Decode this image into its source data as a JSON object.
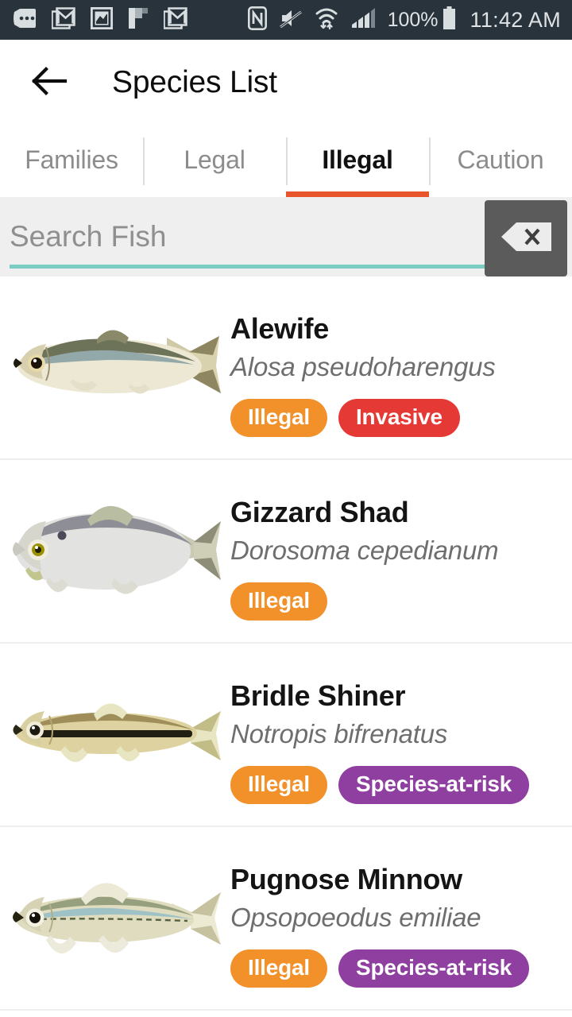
{
  "status_bar": {
    "background": "#28333b",
    "left_icons": [
      {
        "name": "messages-icon",
        "label": "messages"
      },
      {
        "name": "gmail-icon",
        "label": "gmail"
      },
      {
        "name": "photo-icon",
        "label": "photos"
      },
      {
        "name": "flipboard-icon",
        "label": "flipboard"
      },
      {
        "name": "gmail-icon-2",
        "label": "gmail"
      }
    ],
    "right_icons": [
      {
        "name": "nfc-icon",
        "label": "nfc"
      },
      {
        "name": "mute-icon",
        "label": "sound-off"
      },
      {
        "name": "wifi-icon",
        "label": "wifi"
      },
      {
        "name": "cell-signal-icon",
        "label": "signal"
      }
    ],
    "battery_percent": "100%",
    "clock": "11:42 AM"
  },
  "appbar": {
    "back_icon": "back-arrow-icon",
    "title": "Species List"
  },
  "tabs": {
    "active_index": 2,
    "active_color": "#e8552b",
    "items": [
      {
        "label": "Families"
      },
      {
        "label": "Legal"
      },
      {
        "label": "Illegal"
      },
      {
        "label": "Caution"
      }
    ]
  },
  "search": {
    "value": "",
    "placeholder": "Search Fish",
    "underline_color": "#7dccc4",
    "clear_button_icon": "backspace-icon",
    "background": "#efefef"
  },
  "badge_colors": {
    "Illegal": "#f2902a",
    "Invasive": "#e53935",
    "Species-at-risk": "#8e3fa0"
  },
  "species": [
    {
      "common_name": "Alewife",
      "scientific_name": "Alosa pseudoharengus",
      "badges": [
        "Illegal",
        "Invasive"
      ],
      "thumbnail": "alewife-fish-illustration"
    },
    {
      "common_name": "Gizzard Shad",
      "scientific_name": "Dorosoma cepedianum",
      "badges": [
        "Illegal"
      ],
      "thumbnail": "gizzard-shad-fish-illustration"
    },
    {
      "common_name": "Bridle Shiner",
      "scientific_name": "Notropis bifrenatus",
      "badges": [
        "Illegal",
        "Species-at-risk"
      ],
      "thumbnail": "bridle-shiner-fish-illustration"
    },
    {
      "common_name": "Pugnose Minnow",
      "scientific_name": "Opsopoeodus emiliae",
      "badges": [
        "Illegal",
        "Species-at-risk"
      ],
      "thumbnail": "pugnose-minnow-fish-illustration"
    }
  ]
}
